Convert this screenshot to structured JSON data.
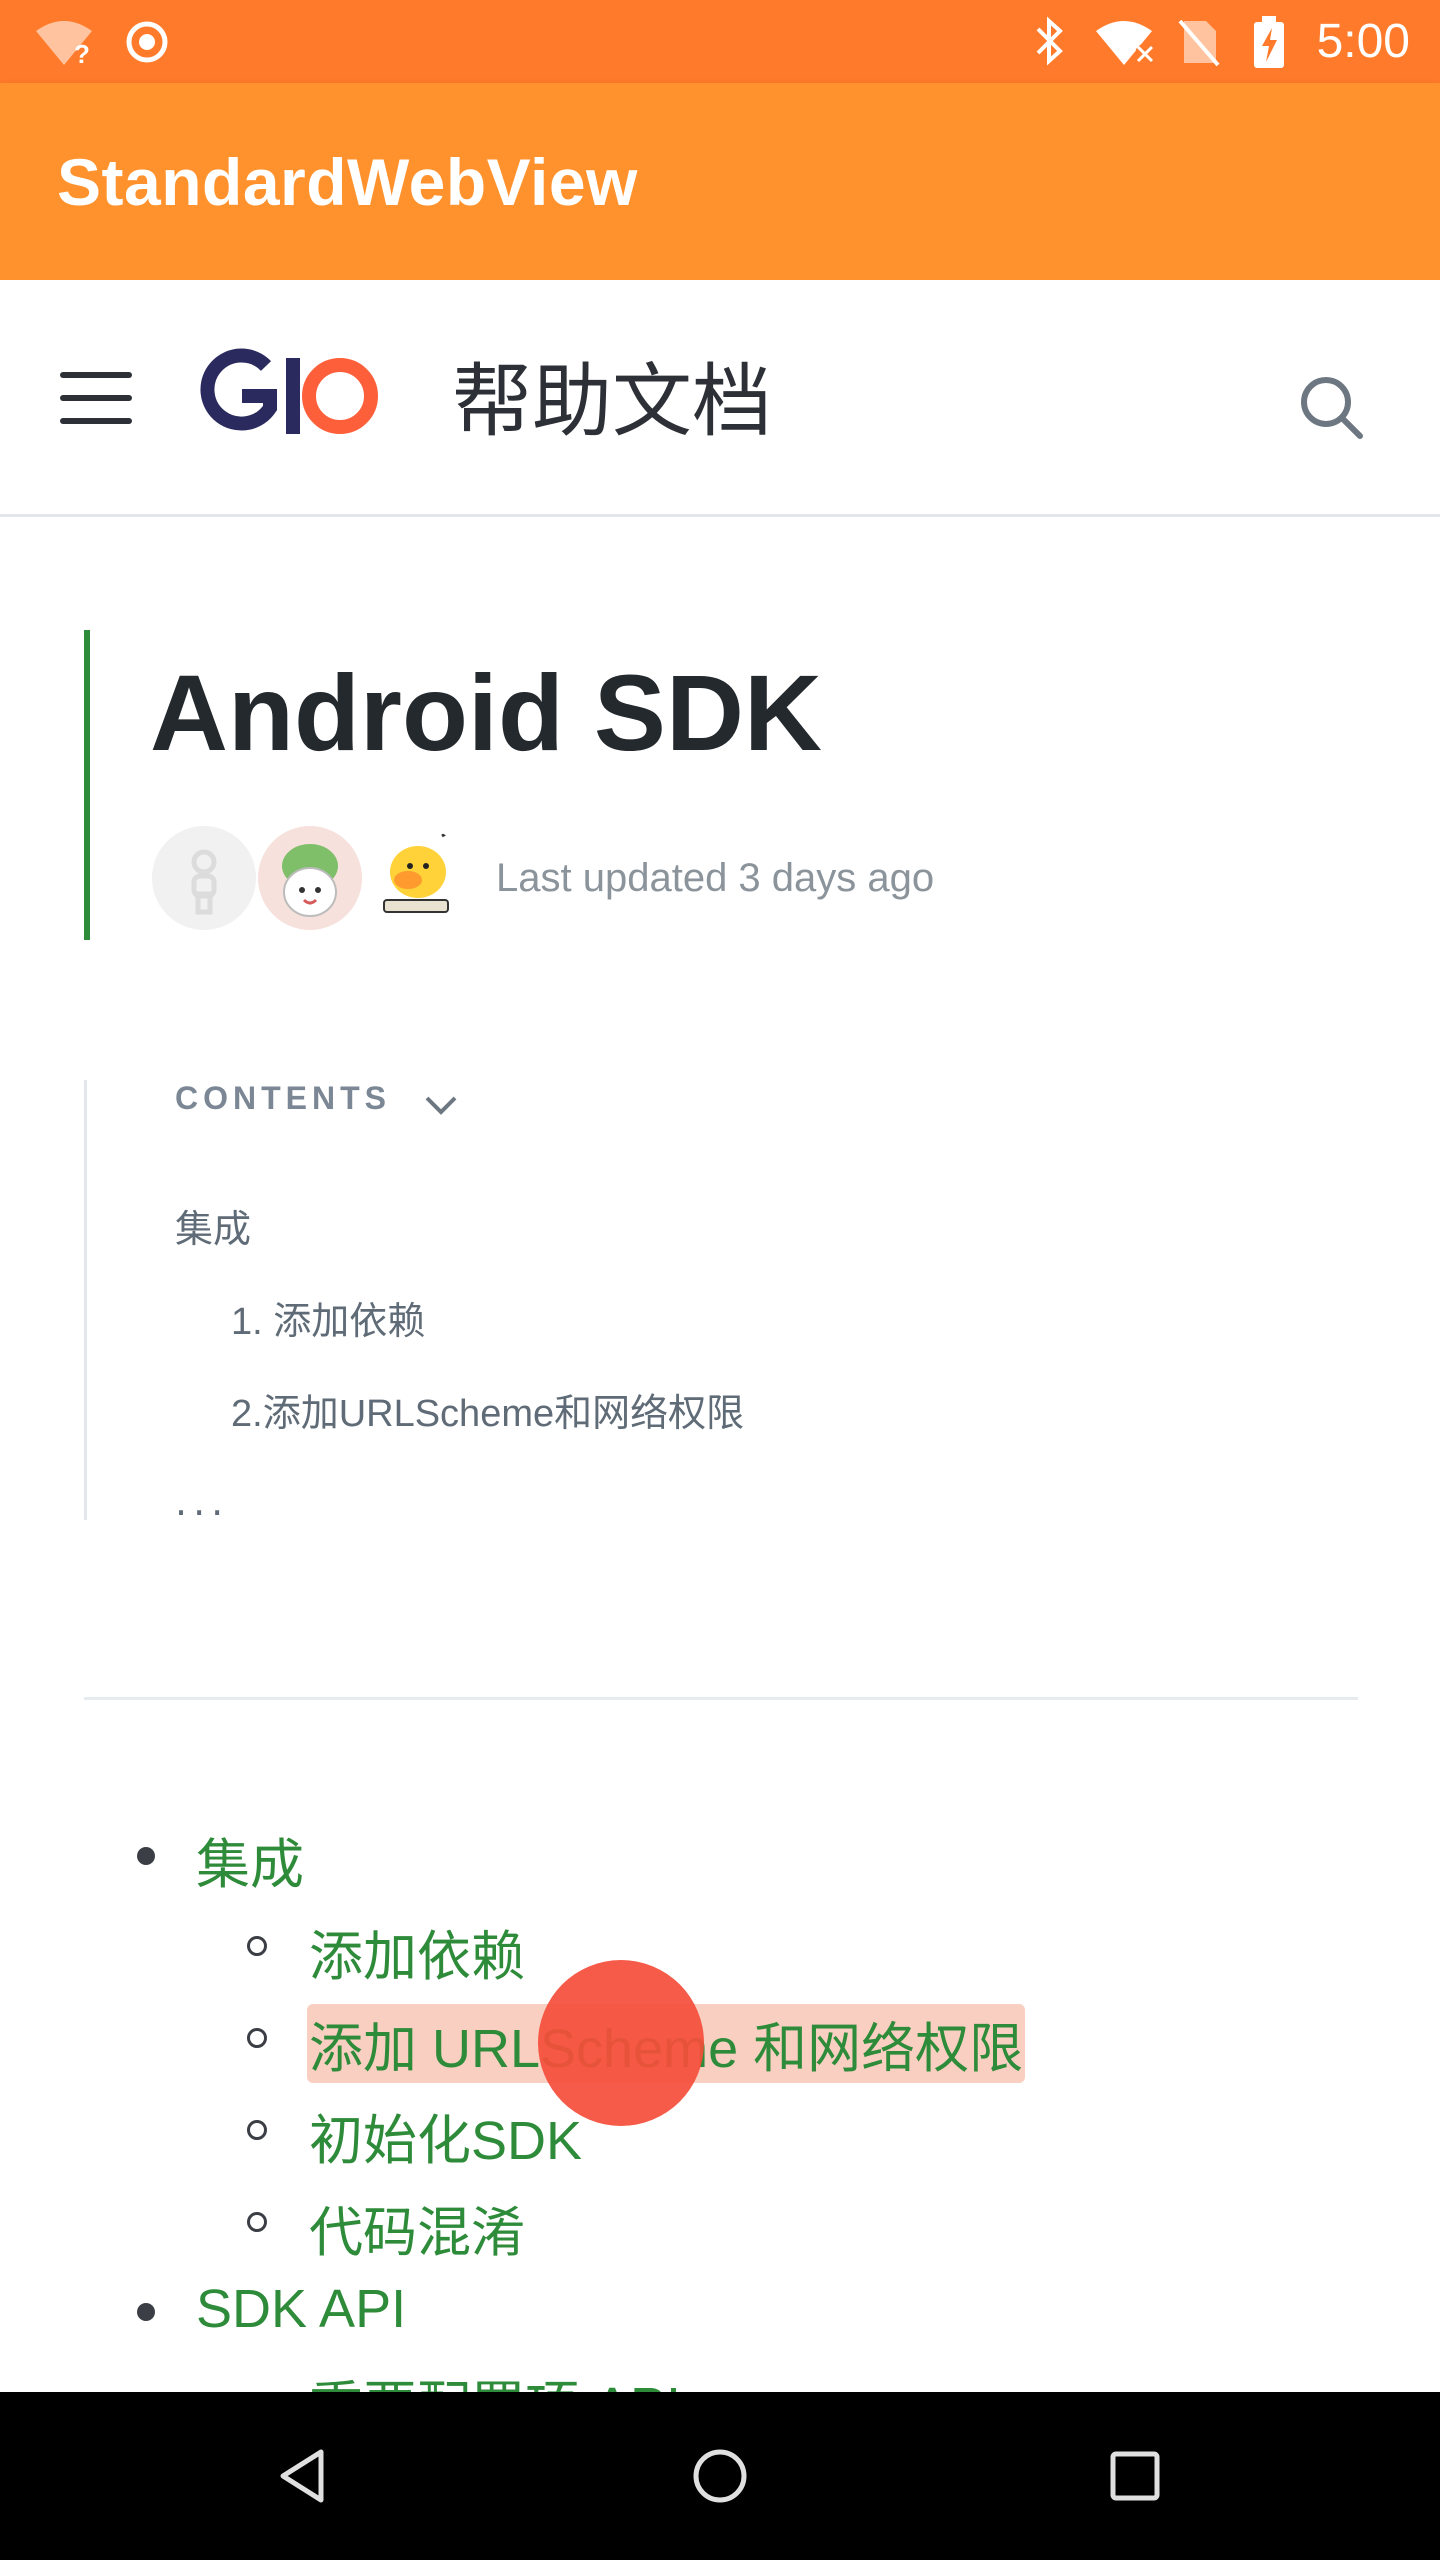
{
  "status_bar": {
    "time": "5:00",
    "icons": [
      "wifi-question-icon",
      "target-icon",
      "bluetooth-icon",
      "wifi-x-icon",
      "no-sim-icon",
      "battery-charging-icon"
    ]
  },
  "app_bar": {
    "title": "StandardWebView"
  },
  "site_header": {
    "logo_text": "GIO",
    "title": "帮助文档",
    "colors": {
      "logo_dark": "#2a2a5e",
      "logo_accent": "#fc5f3a"
    }
  },
  "page": {
    "title": "Android SDK",
    "last_updated": "Last updated 3 days ago",
    "accent_color": "#2e8b3a"
  },
  "toc": {
    "heading": "CONTENTS",
    "items": [
      {
        "label": "集成",
        "level": 1
      },
      {
        "label": "1. 添加依赖",
        "level": 2
      },
      {
        "label": "2.添加URLScheme和网络权限",
        "level": 2
      }
    ],
    "more": "..."
  },
  "nav_links": [
    {
      "label": "集成",
      "level": 1
    },
    {
      "label": "添加依赖",
      "level": 2
    },
    {
      "label": "添加 URLScheme 和网络权限",
      "level": 2,
      "highlighted": true
    },
    {
      "label": "初始化SDK",
      "level": 2
    },
    {
      "label": "代码混淆",
      "level": 2
    },
    {
      "label": "SDK API",
      "level": 1
    },
    {
      "label": "重要配置项 API",
      "level": 2
    }
  ],
  "system_nav": [
    "back-icon",
    "home-icon",
    "recents-icon"
  ]
}
